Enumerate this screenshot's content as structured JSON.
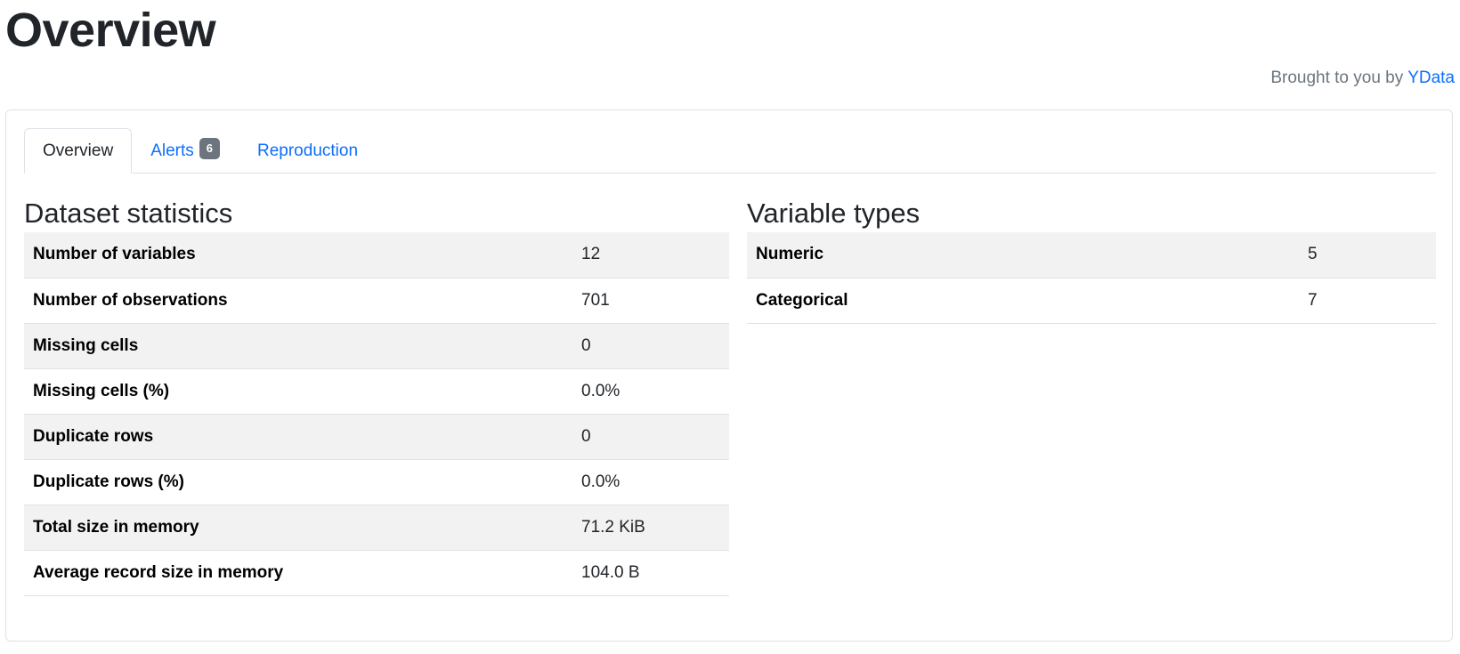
{
  "header": {
    "title": "Overview",
    "credit_prefix": "Brought to you by ",
    "credit_link": "YData"
  },
  "tabs": [
    {
      "label": "Overview",
      "active": true
    },
    {
      "label": "Alerts",
      "badge": "6",
      "active": false
    },
    {
      "label": "Reproduction",
      "active": false
    }
  ],
  "dataset_statistics": {
    "title": "Dataset statistics",
    "rows": [
      {
        "label": "Number of variables",
        "value": "12"
      },
      {
        "label": "Number of observations",
        "value": "701"
      },
      {
        "label": "Missing cells",
        "value": "0"
      },
      {
        "label": "Missing cells (%)",
        "value": "0.0%"
      },
      {
        "label": "Duplicate rows",
        "value": "0"
      },
      {
        "label": "Duplicate rows (%)",
        "value": "0.0%"
      },
      {
        "label": "Total size in memory",
        "value": "71.2 KiB"
      },
      {
        "label": "Average record size in memory",
        "value": "104.0 B"
      }
    ]
  },
  "variable_types": {
    "title": "Variable types",
    "rows": [
      {
        "label": "Numeric",
        "value": "5"
      },
      {
        "label": "Categorical",
        "value": "7"
      }
    ]
  },
  "colors": {
    "link": "#0d6efd",
    "badge": "#6c757d",
    "striped_row": "#f2f2f2",
    "border": "#dee2e6"
  }
}
